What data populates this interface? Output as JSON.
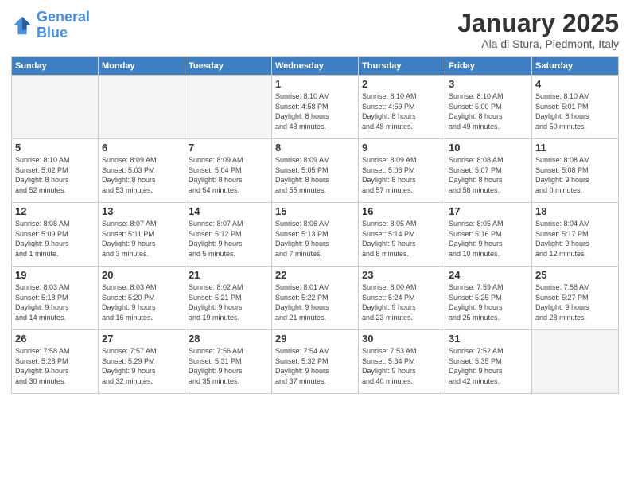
{
  "logo": {
    "line1": "General",
    "line2": "Blue"
  },
  "header": {
    "month": "January 2025",
    "location": "Ala di Stura, Piedmont, Italy"
  },
  "weekdays": [
    "Sunday",
    "Monday",
    "Tuesday",
    "Wednesday",
    "Thursday",
    "Friday",
    "Saturday"
  ],
  "weeks": [
    [
      {
        "day": "",
        "info": ""
      },
      {
        "day": "",
        "info": ""
      },
      {
        "day": "",
        "info": ""
      },
      {
        "day": "1",
        "info": "Sunrise: 8:10 AM\nSunset: 4:58 PM\nDaylight: 8 hours\nand 48 minutes."
      },
      {
        "day": "2",
        "info": "Sunrise: 8:10 AM\nSunset: 4:59 PM\nDaylight: 8 hours\nand 48 minutes."
      },
      {
        "day": "3",
        "info": "Sunrise: 8:10 AM\nSunset: 5:00 PM\nDaylight: 8 hours\nand 49 minutes."
      },
      {
        "day": "4",
        "info": "Sunrise: 8:10 AM\nSunset: 5:01 PM\nDaylight: 8 hours\nand 50 minutes."
      }
    ],
    [
      {
        "day": "5",
        "info": "Sunrise: 8:10 AM\nSunset: 5:02 PM\nDaylight: 8 hours\nand 52 minutes."
      },
      {
        "day": "6",
        "info": "Sunrise: 8:09 AM\nSunset: 5:03 PM\nDaylight: 8 hours\nand 53 minutes."
      },
      {
        "day": "7",
        "info": "Sunrise: 8:09 AM\nSunset: 5:04 PM\nDaylight: 8 hours\nand 54 minutes."
      },
      {
        "day": "8",
        "info": "Sunrise: 8:09 AM\nSunset: 5:05 PM\nDaylight: 8 hours\nand 55 minutes."
      },
      {
        "day": "9",
        "info": "Sunrise: 8:09 AM\nSunset: 5:06 PM\nDaylight: 8 hours\nand 57 minutes."
      },
      {
        "day": "10",
        "info": "Sunrise: 8:08 AM\nSunset: 5:07 PM\nDaylight: 8 hours\nand 58 minutes."
      },
      {
        "day": "11",
        "info": "Sunrise: 8:08 AM\nSunset: 5:08 PM\nDaylight: 9 hours\nand 0 minutes."
      }
    ],
    [
      {
        "day": "12",
        "info": "Sunrise: 8:08 AM\nSunset: 5:09 PM\nDaylight: 9 hours\nand 1 minute."
      },
      {
        "day": "13",
        "info": "Sunrise: 8:07 AM\nSunset: 5:11 PM\nDaylight: 9 hours\nand 3 minutes."
      },
      {
        "day": "14",
        "info": "Sunrise: 8:07 AM\nSunset: 5:12 PM\nDaylight: 9 hours\nand 5 minutes."
      },
      {
        "day": "15",
        "info": "Sunrise: 8:06 AM\nSunset: 5:13 PM\nDaylight: 9 hours\nand 7 minutes."
      },
      {
        "day": "16",
        "info": "Sunrise: 8:05 AM\nSunset: 5:14 PM\nDaylight: 9 hours\nand 8 minutes."
      },
      {
        "day": "17",
        "info": "Sunrise: 8:05 AM\nSunset: 5:16 PM\nDaylight: 9 hours\nand 10 minutes."
      },
      {
        "day": "18",
        "info": "Sunrise: 8:04 AM\nSunset: 5:17 PM\nDaylight: 9 hours\nand 12 minutes."
      }
    ],
    [
      {
        "day": "19",
        "info": "Sunrise: 8:03 AM\nSunset: 5:18 PM\nDaylight: 9 hours\nand 14 minutes."
      },
      {
        "day": "20",
        "info": "Sunrise: 8:03 AM\nSunset: 5:20 PM\nDaylight: 9 hours\nand 16 minutes."
      },
      {
        "day": "21",
        "info": "Sunrise: 8:02 AM\nSunset: 5:21 PM\nDaylight: 9 hours\nand 19 minutes."
      },
      {
        "day": "22",
        "info": "Sunrise: 8:01 AM\nSunset: 5:22 PM\nDaylight: 9 hours\nand 21 minutes."
      },
      {
        "day": "23",
        "info": "Sunrise: 8:00 AM\nSunset: 5:24 PM\nDaylight: 9 hours\nand 23 minutes."
      },
      {
        "day": "24",
        "info": "Sunrise: 7:59 AM\nSunset: 5:25 PM\nDaylight: 9 hours\nand 25 minutes."
      },
      {
        "day": "25",
        "info": "Sunrise: 7:58 AM\nSunset: 5:27 PM\nDaylight: 9 hours\nand 28 minutes."
      }
    ],
    [
      {
        "day": "26",
        "info": "Sunrise: 7:58 AM\nSunset: 5:28 PM\nDaylight: 9 hours\nand 30 minutes."
      },
      {
        "day": "27",
        "info": "Sunrise: 7:57 AM\nSunset: 5:29 PM\nDaylight: 9 hours\nand 32 minutes."
      },
      {
        "day": "28",
        "info": "Sunrise: 7:56 AM\nSunset: 5:31 PM\nDaylight: 9 hours\nand 35 minutes."
      },
      {
        "day": "29",
        "info": "Sunrise: 7:54 AM\nSunset: 5:32 PM\nDaylight: 9 hours\nand 37 minutes."
      },
      {
        "day": "30",
        "info": "Sunrise: 7:53 AM\nSunset: 5:34 PM\nDaylight: 9 hours\nand 40 minutes."
      },
      {
        "day": "31",
        "info": "Sunrise: 7:52 AM\nSunset: 5:35 PM\nDaylight: 9 hours\nand 42 minutes."
      },
      {
        "day": "",
        "info": ""
      }
    ]
  ]
}
